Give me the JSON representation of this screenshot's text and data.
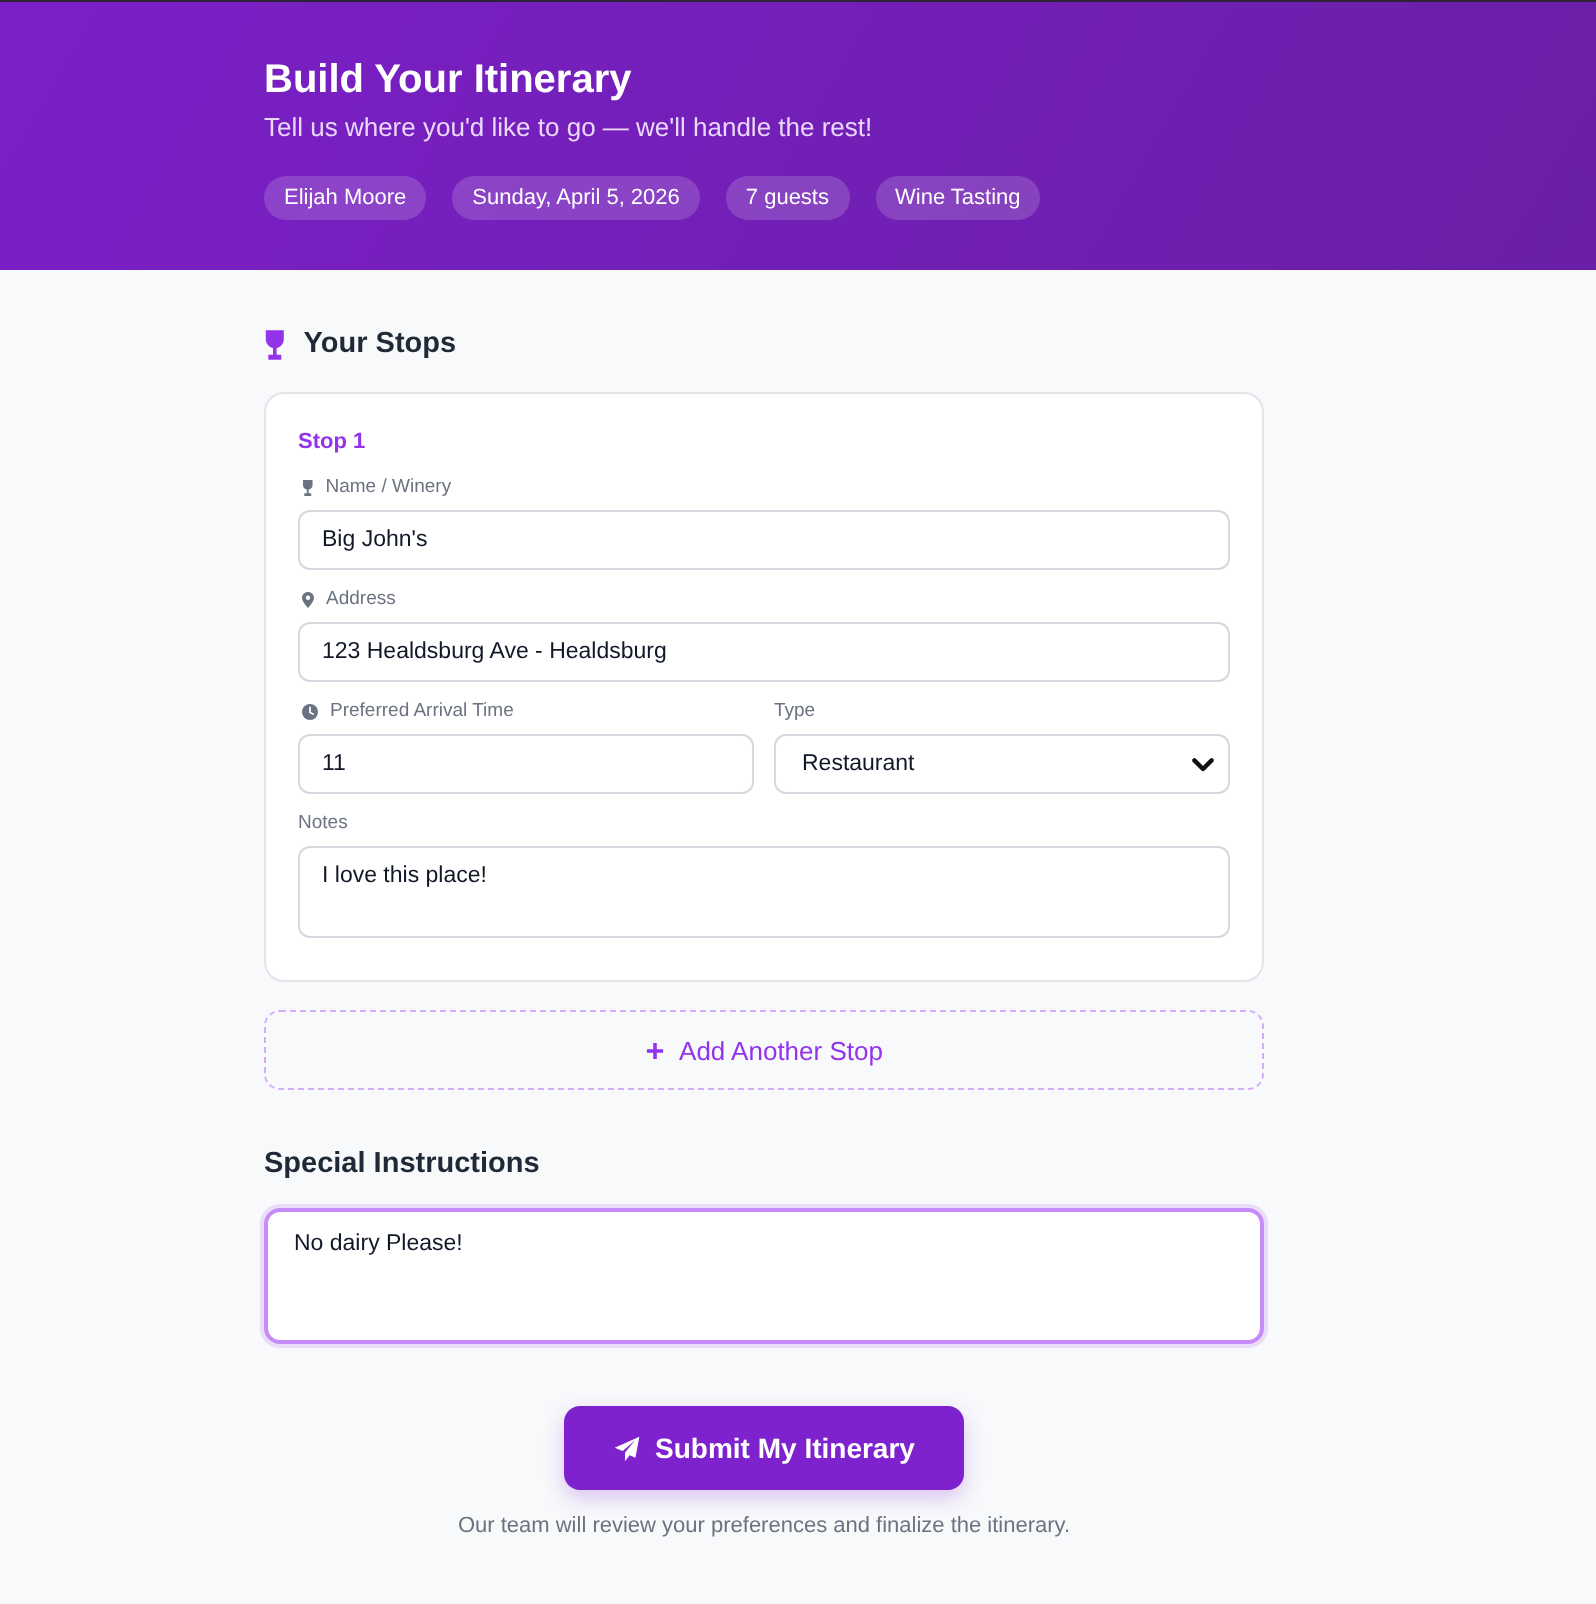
{
  "header": {
    "title": "Build Your Itinerary",
    "subtitle": "Tell us where you'd like to go — we'll handle the rest!",
    "chips": [
      "Elijah Moore",
      "Sunday, April 5, 2026",
      "7 guests",
      "Wine Tasting"
    ]
  },
  "stops_section": {
    "title": "Your Stops"
  },
  "stops": [
    {
      "heading": "Stop 1",
      "name": {
        "label": "Name / Winery",
        "value": "Big John's"
      },
      "address": {
        "label": "Address",
        "value": "123 Healdsburg Ave - Healdsburg"
      },
      "arrival_time": {
        "label": "Preferred Arrival Time",
        "value": "11"
      },
      "type": {
        "label": "Type",
        "value": "Restaurant"
      },
      "notes": {
        "label": "Notes",
        "value": "I love this place!"
      }
    }
  ],
  "add_stop_button": {
    "label": "Add Another Stop"
  },
  "special_instructions": {
    "title": "Special Instructions",
    "value": "No dairy Please!",
    "focused": true
  },
  "submit_button": {
    "label": "Submit My Itinerary"
  },
  "footer_note": "Our team will review your preferences and finalize the itinerary."
}
